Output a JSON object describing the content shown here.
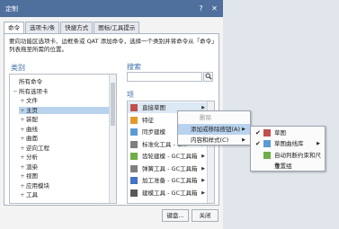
{
  "window": {
    "title": "定制",
    "help_btn": "?",
    "close_btn": "✕"
  },
  "tabs": [
    "命令",
    "选项卡/条",
    "快捷方式",
    "图标/工具提示"
  ],
  "description": "要向功能区选项卡、边框条或 QAT 添加命令，选择一个类别并将命令从「命令」列表拖至所需的位置。",
  "category": {
    "label": "类别",
    "items": [
      {
        "label": "所有命令",
        "exp": ""
      },
      {
        "label": "所有选项卡",
        "exp": "−"
      },
      {
        "label": "文件",
        "exp": "+"
      },
      {
        "label": "主页",
        "exp": "+"
      },
      {
        "label": "装配",
        "exp": "+"
      },
      {
        "label": "曲线",
        "exp": "+"
      },
      {
        "label": "曲面",
        "exp": "+"
      },
      {
        "label": "逆向工程",
        "exp": "+"
      },
      {
        "label": "分析",
        "exp": "+"
      },
      {
        "label": "渲染",
        "exp": "+"
      },
      {
        "label": "视图",
        "exp": "+"
      },
      {
        "label": "应用模块",
        "exp": "+"
      },
      {
        "label": "工具",
        "exp": "+"
      }
    ],
    "selected_index": 3
  },
  "search": {
    "label": "搜索",
    "value": "",
    "icon": "search-icon"
  },
  "commands": {
    "label": "项",
    "items": [
      {
        "label": "直接草图",
        "has_sub": true,
        "color": "#c0504d"
      },
      {
        "label": "特征",
        "has_sub": false,
        "color": "#e39a2d"
      },
      {
        "label": "同步建模",
        "has_sub": false,
        "color": "#5b9bd5"
      },
      {
        "label": "标准化工具 - G...",
        "has_sub": true,
        "color": "#7f7f7f"
      },
      {
        "label": "齿轮建模 - GC工具箱",
        "has_sub": true,
        "color": "#70ad47"
      },
      {
        "label": "弹簧工具 - GC工具箱",
        "has_sub": true,
        "color": "#7f7f7f"
      },
      {
        "label": "加工准备 - GC工具箱",
        "has_sub": true,
        "color": "#4472c4"
      },
      {
        "label": "建模工具 - GC工具箱",
        "has_sub": true,
        "color": "#595959"
      }
    ],
    "highlighted_index": 0
  },
  "buttons": {
    "keyboard": "键盘...",
    "close": "关闭"
  },
  "context_menu": {
    "items": [
      {
        "label": "删除",
        "disabled": true
      },
      {
        "label": "添加或移除按钮(A)",
        "has_sub": true,
        "highlighted": true
      },
      {
        "label": "内容和样式(C)",
        "has_sub": true,
        "highlighted": false
      }
    ]
  },
  "submenu": {
    "items": [
      {
        "label": "草图",
        "checked": true
      },
      {
        "label": "草图曲线库",
        "checked": true,
        "has_sub": true
      },
      {
        "label": "自动判断约束和尺寸",
        "checked": false
      },
      {
        "label": "重置组",
        "checked": false
      }
    ]
  }
}
